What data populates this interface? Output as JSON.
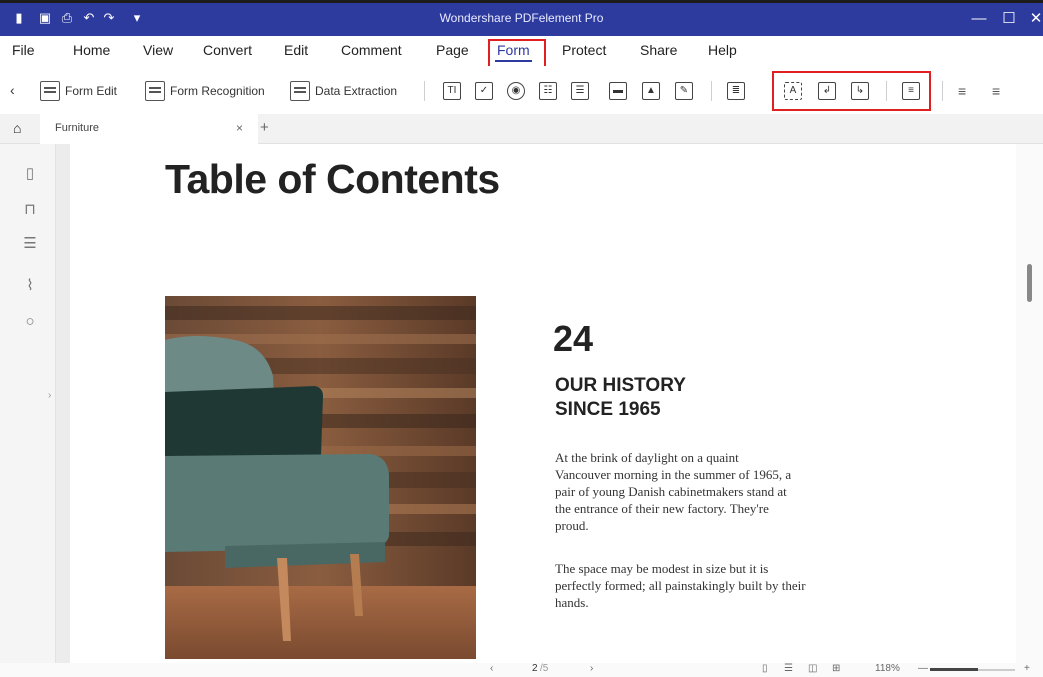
{
  "app": {
    "title": "Wondershare PDFelement Pro",
    "colors": {
      "titlebar": "#2d3a9e",
      "highlight": "#e02020"
    },
    "quick_icons": [
      "app-logo-icon",
      "save-icon",
      "print-icon",
      "undo-icon",
      "redo-icon",
      "customize-arrow-icon"
    ],
    "window_controls": {
      "minimize": "—",
      "maximize": "☐",
      "close": "✕"
    }
  },
  "menu": {
    "items": [
      "File",
      "Home",
      "View",
      "Convert",
      "Edit",
      "Comment",
      "Page",
      "Form",
      "Protect",
      "Share",
      "Help"
    ],
    "active": "Form"
  },
  "toolbar": {
    "collapse": "‹",
    "form_edit": "Form Edit",
    "form_recognition": "Form Recognition",
    "data_extraction": "Data Extraction",
    "field_icons": [
      "text-field-icon",
      "checkbox-icon",
      "radio-button-icon",
      "list-box-icon",
      "combo-box-icon",
      "button-field-icon",
      "image-field-icon",
      "signature-field-icon"
    ],
    "field_glyphs": [
      "TI",
      "✓",
      "◉",
      "☷",
      "☰",
      "▬",
      "▲",
      "✎"
    ],
    "extra_icon": "form-properties-icon",
    "highlighted_icons": [
      "clear-form-icon",
      "import-form-icon",
      "export-form-icon",
      "reset-form-icon"
    ],
    "align_icons": [
      "align-left-icon",
      "align-center-icon"
    ]
  },
  "tabs": {
    "home_icon": "home-icon",
    "items": [
      {
        "label": "Furniture",
        "close": "×"
      }
    ],
    "add": "+"
  },
  "sidebar": {
    "icons": [
      "pages-icon",
      "bookmark-icon",
      "comment-icon",
      "attachment-icon",
      "search-icon"
    ],
    "expand": "›"
  },
  "document": {
    "heading": "Table of Contents",
    "number": "24",
    "section_title_line1": "OUR HISTORY",
    "section_title_line2": "SINCE 1965",
    "paragraph1": "At the brink of daylight on a quaint Vancouver morning in the summer of 1965, a pair of young Danish cabinetmakers stand at the entrance of their new factory. They're proud.",
    "paragraph2": "The space may be modest in size but it is perfectly formed; all painstakingly built by their hands."
  },
  "status": {
    "prev": "‹",
    "page_current": "2",
    "page_total": "/5",
    "next": "›",
    "view_icons": [
      "single-page-icon",
      "continuous-icon",
      "two-page-icon",
      "thumbnail-view-icon"
    ],
    "zoom": "118%",
    "zoom_minus": "—",
    "zoom_plus": "+"
  }
}
